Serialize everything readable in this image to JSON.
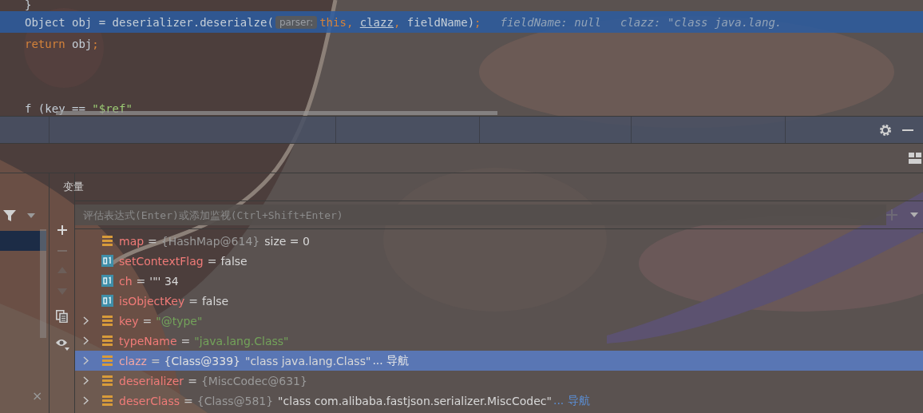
{
  "editor": {
    "lines": [
      {
        "current": false,
        "tokens": [
          {
            "text": "}",
            "kind": "plain"
          }
        ]
      },
      {
        "current": true,
        "tokens": [
          {
            "text": "Object obj = deserializer.deserialze(",
            "kind": "plain"
          },
          {
            "text": "parser:",
            "kind": "hint"
          },
          {
            "text": "this",
            "kind": "keyword"
          },
          {
            "text": ", ",
            "kind": "keyword"
          },
          {
            "text": "clazz",
            "kind": "underlined"
          },
          {
            "text": ", ",
            "kind": "keyword"
          },
          {
            "text": "fieldName)",
            "kind": "plain"
          },
          {
            "text": ";",
            "kind": "keyword"
          },
          {
            "text": "fieldName: null",
            "kind": "inline-value"
          },
          {
            "text": "clazz: \"class java.lang.",
            "kind": "inline-value"
          }
        ]
      },
      {
        "current": false,
        "tokens": [
          {
            "text": "return",
            "kind": "keyword"
          },
          {
            "text": " obj",
            "kind": "plain"
          },
          {
            "text": ";",
            "kind": "keyword"
          }
        ]
      },
      {
        "current": false
      },
      {
        "current": false
      },
      {
        "current": false,
        "tokens": [
          {
            "text": "f (key == ",
            "kind": "plain"
          },
          {
            "text": "\"$ref\"",
            "kind": "string"
          }
        ]
      }
    ]
  },
  "variables_panel": {
    "title": "变量",
    "watch_field": {
      "placeholder": "评估表达式(Enter)或添加监视(Ctrl+Shift+Enter)"
    },
    "frames_close": "×",
    "rows": [
      {
        "name": "map",
        "operator": "=",
        "kind": "object",
        "expandable": false,
        "selected": false,
        "value": [
          {
            "text": "{HashMap@614}",
            "kind": "ref"
          },
          {
            "text": "size = 0",
            "kind": "plain"
          }
        ]
      },
      {
        "name": "setContextFlag",
        "operator": "=",
        "kind": "primitive",
        "expandable": false,
        "selected": false,
        "value": [
          {
            "text": "false",
            "kind": "plain"
          }
        ]
      },
      {
        "name": "ch",
        "operator": "=",
        "kind": "primitive",
        "expandable": false,
        "selected": false,
        "value": [
          {
            "text": "'\"' 34",
            "kind": "plain"
          }
        ]
      },
      {
        "name": "isObjectKey",
        "operator": "=",
        "kind": "primitive",
        "expandable": false,
        "selected": false,
        "value": [
          {
            "text": "false",
            "kind": "plain"
          }
        ]
      },
      {
        "name": "key",
        "operator": "=",
        "kind": "object",
        "expandable": true,
        "selected": false,
        "value": [
          {
            "text": "\"@type\"",
            "kind": "string"
          }
        ]
      },
      {
        "name": "typeName",
        "operator": "=",
        "kind": "object",
        "expandable": true,
        "selected": false,
        "value": [
          {
            "text": "\"java.lang.Class\"",
            "kind": "string"
          }
        ]
      },
      {
        "name": "clazz",
        "operator": "=",
        "kind": "object",
        "expandable": true,
        "selected": true,
        "value": [
          {
            "text": "{Class@339}",
            "kind": "ref"
          },
          {
            "text": "\"class java.lang.Class\"",
            "kind": "plain"
          },
          {
            "text": "... 导航",
            "kind": "link"
          }
        ]
      },
      {
        "name": "deserializer",
        "operator": "=",
        "kind": "object",
        "expandable": true,
        "selected": false,
        "value": [
          {
            "text": "{MiscCodec@631}",
            "kind": "ref"
          }
        ]
      },
      {
        "name": "deserClass",
        "operator": "=",
        "kind": "object",
        "expandable": true,
        "selected": false,
        "value": [
          {
            "text": "{Class@581}",
            "kind": "ref"
          },
          {
            "text": "\"class com.alibaba.fastjson.serializer.MiscCodec\"",
            "kind": "plain"
          },
          {
            "text": "... 导航",
            "kind": "link"
          }
        ]
      }
    ]
  }
}
